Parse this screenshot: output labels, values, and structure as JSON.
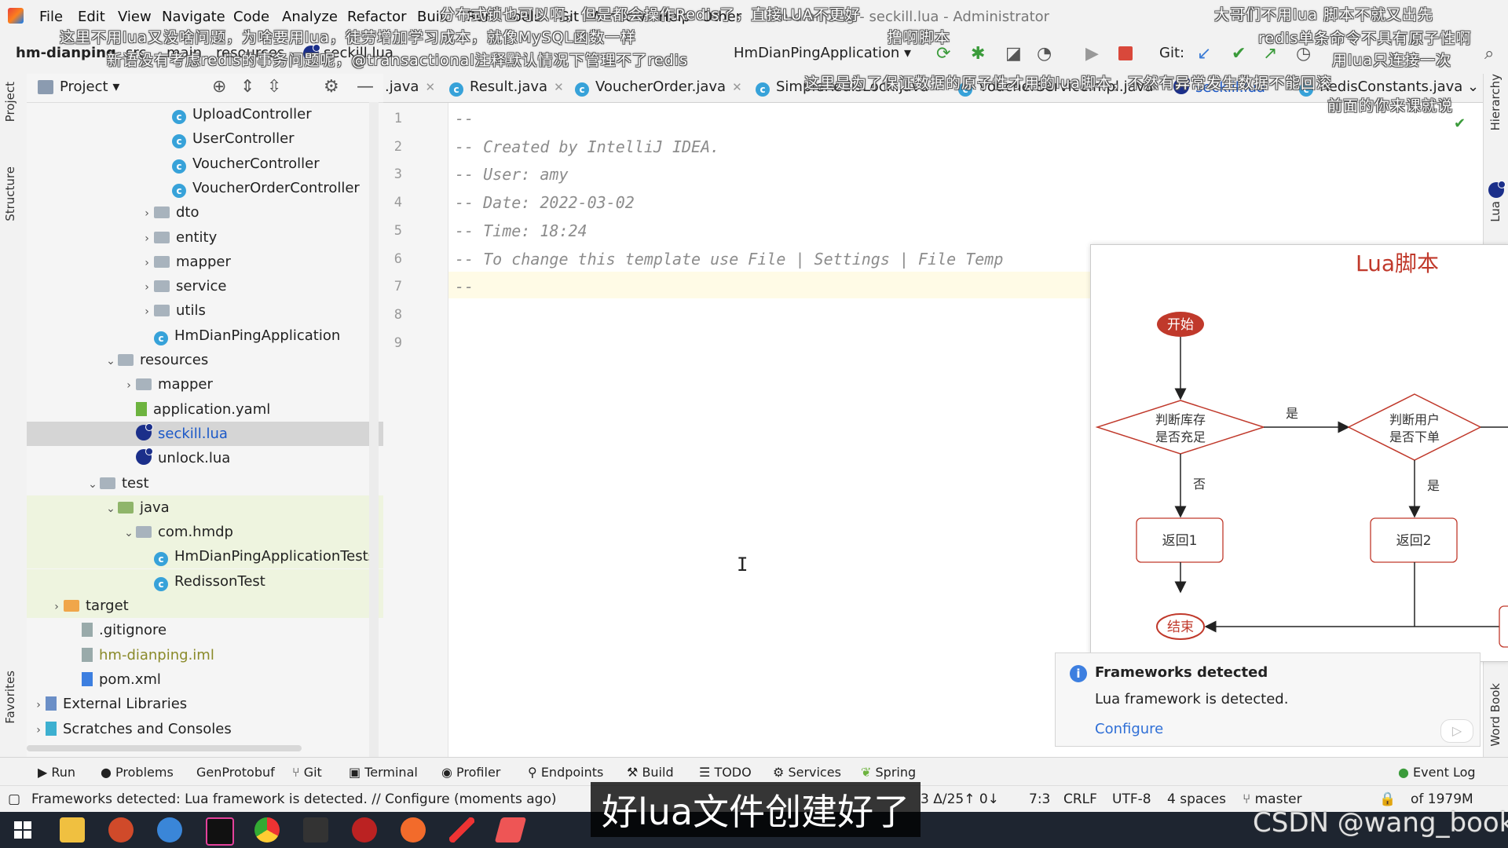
{
  "menu": {
    "items": [
      "File",
      "Edit",
      "View",
      "Navigate",
      "Code",
      "Analyze",
      "Refactor",
      "Build",
      "Run",
      "Tools",
      "Git",
      "Window",
      "Help",
      "Other"
    ],
    "window_title": "hm-dianping - seckill.lua - Administrator"
  },
  "toolbar": {
    "project": "hm-dianping",
    "crumbs": [
      "src",
      "main",
      "resources",
      "seckill.lua"
    ],
    "run_config": "HmDianPingApplication",
    "git_label": "Git:"
  },
  "danmaku": [
    "分布式锁也可以啊，但是都会操作Redis了，直接LUA不更好",
    "这里不用lua又没啥问题，为啥要用lua，徒劳增加学习成本，就像MySQL函数一样",
    "新语没有考虑redis的事务问题呢，@transactional注释默认情况下管理不了redis",
    "大哥们不用lua 脚本不就又出先",
    "redis单条命令不具有原子性啊",
    "用lua只连接一次",
    "撸啊脚本",
    "这里是为了保证数据的原子性才用的lua脚本，不然有异常发生数据不能回滚",
    "前面的你来课就说"
  ],
  "left_strip": {
    "tabs": [
      "Project",
      "Structure",
      "Favorites"
    ]
  },
  "project_panel": {
    "title": "Project",
    "tree": [
      {
        "label": "UploadController",
        "kind": "class",
        "depth": 7,
        "chevron": ""
      },
      {
        "label": "UserController",
        "kind": "class",
        "depth": 7,
        "chevron": ""
      },
      {
        "label": "VoucherController",
        "kind": "class",
        "depth": 7,
        "chevron": ""
      },
      {
        "label": "VoucherOrderController",
        "kind": "class",
        "depth": 7,
        "chevron": ""
      },
      {
        "label": "dto",
        "kind": "folder",
        "depth": 6,
        "chevron": "›"
      },
      {
        "label": "entity",
        "kind": "folder",
        "depth": 6,
        "chevron": "›"
      },
      {
        "label": "mapper",
        "kind": "folder",
        "depth": 6,
        "chevron": "›"
      },
      {
        "label": "service",
        "kind": "folder",
        "depth": 6,
        "chevron": "›"
      },
      {
        "label": "utils",
        "kind": "folder",
        "depth": 6,
        "chevron": "›"
      },
      {
        "label": "HmDianPingApplication",
        "kind": "app",
        "depth": 6,
        "chevron": ""
      },
      {
        "label": "resources",
        "kind": "res",
        "depth": 4,
        "chevron": "⌄"
      },
      {
        "label": "mapper",
        "kind": "folder",
        "depth": 5,
        "chevron": "›"
      },
      {
        "label": "application.yaml",
        "kind": "yaml",
        "depth": 5,
        "chevron": ""
      },
      {
        "label": "seckill.lua",
        "kind": "lua",
        "depth": 5,
        "chevron": "",
        "selected": true
      },
      {
        "label": "unlock.lua",
        "kind": "lua",
        "depth": 5,
        "chevron": ""
      },
      {
        "label": "test",
        "kind": "folder",
        "depth": 3,
        "chevron": "⌄"
      },
      {
        "label": "java",
        "kind": "folderg",
        "depth": 4,
        "chevron": "⌄",
        "green": true
      },
      {
        "label": "com.hmdp",
        "kind": "folder",
        "depth": 5,
        "chevron": "⌄",
        "green": true
      },
      {
        "label": "HmDianPingApplicationTests",
        "kind": "app",
        "depth": 6,
        "chevron": "",
        "green": true
      },
      {
        "label": "RedissonTest",
        "kind": "app",
        "depth": 6,
        "chevron": "",
        "green": true
      },
      {
        "label": "target",
        "kind": "foldero",
        "depth": 1,
        "chevron": "›",
        "green": true
      },
      {
        "label": ".gitignore",
        "kind": "file",
        "depth": 2,
        "chevron": ""
      },
      {
        "label": "hm-dianping.iml",
        "kind": "file",
        "depth": 2,
        "chevron": ""
      },
      {
        "label": "pom.xml",
        "kind": "maven",
        "depth": 2,
        "chevron": ""
      },
      {
        "label": "External Libraries",
        "kind": "lib",
        "depth": 0,
        "chevron": "›"
      },
      {
        "label": "Scratches and Consoles",
        "kind": "scratch",
        "depth": 0,
        "chevron": "›"
      }
    ]
  },
  "editor_tabs": [
    {
      "label": ".java",
      "active": false
    },
    {
      "label": "Result.java",
      "active": false
    },
    {
      "label": "VoucherOrder.java",
      "active": false
    },
    {
      "label": "SimpleRedisLock.java",
      "active": false
    },
    {
      "label": "VoucherServiceImpl.java",
      "active": false
    },
    {
      "label": "seckill.lua",
      "active": true
    },
    {
      "label": "RedisConstants.java",
      "active": false
    }
  ],
  "editor": {
    "lines": [
      "--",
      "-- Created by IntelliJ IDEA.",
      "-- User: amy",
      "-- Date: 2022-03-02",
      "-- Time: 18:24",
      "-- To change this template use File | Settings | File Temp",
      "--",
      "",
      ""
    ],
    "line_numbers": [
      "1",
      "2",
      "3",
      "4",
      "5",
      "6",
      "7",
      "8",
      "9"
    ]
  },
  "right_strip": {
    "tabs": [
      "Hierarchy",
      "Lua",
      "Word Book"
    ]
  },
  "diagram": {
    "title": "Lua脚本",
    "start": "开始",
    "check_stock": [
      "判断库存",
      "是否充足"
    ],
    "check_user": [
      "判断用户",
      "是否下单"
    ],
    "yes1": "是",
    "no1": "否",
    "yes2": "是",
    "return1": "返回1",
    "return2": "返回2",
    "end": "结束",
    "accent": "#c0392b"
  },
  "notification": {
    "title": "Frameworks detected",
    "body": "Lua framework is detected.",
    "link": "Configure"
  },
  "bottom_tools": [
    "Run",
    "Problems",
    "GenProtobuf",
    "Git",
    "Terminal",
    "Profiler",
    "Endpoints",
    "Build",
    "TODO",
    "Services",
    "Spring"
  ],
  "event_log": "Event Log",
  "status": {
    "message": "Frameworks detected: Lua framework is detected. // Configure (moments ago)",
    "changes": "3 Δ/25↑ 0↓",
    "position": "7:3",
    "line_sep": "CRLF",
    "encoding": "UTF-8",
    "indent": "4 spaces",
    "branch": "master",
    "memory": "of 1979M"
  },
  "subtitle": "好lua文件创建好了",
  "watermark": "CSDN @wang_book"
}
